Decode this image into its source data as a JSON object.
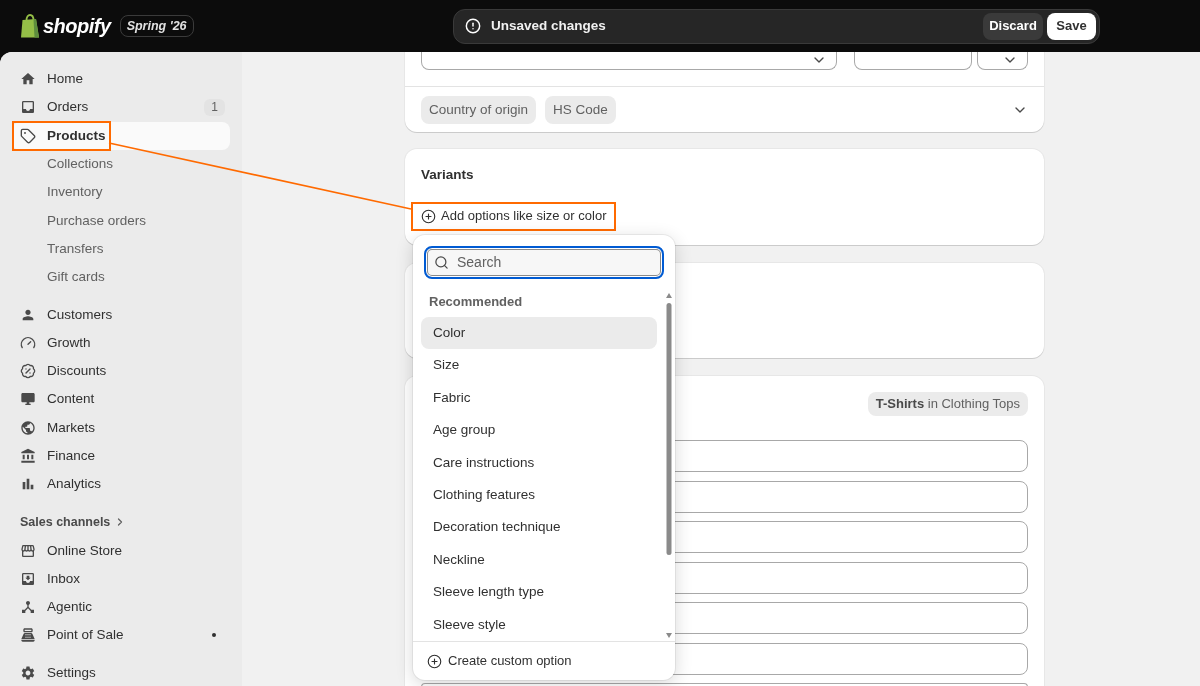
{
  "top_bar": {
    "logo": "shopify",
    "edition": "Spring '26",
    "save_bar": {
      "message": "Unsaved changes",
      "actions": [
        {
          "label": "Discard",
          "kind": "secondary"
        },
        {
          "label": "Save",
          "kind": "primary"
        }
      ]
    }
  },
  "sidebar": {
    "sections": [
      {
        "items": [
          {
            "label": "Home",
            "selected": false,
            "highlighted": false
          },
          {
            "label": "Orders",
            "selected": false,
            "highlighted": false,
            "badge": "1"
          },
          {
            "label": "Products",
            "selected": true,
            "highlighted": true,
            "children": [
              {
                "label": "Collections",
                "selected": false,
                "highlighted": false
              },
              {
                "label": "Inventory",
                "selected": false,
                "highlighted": false
              },
              {
                "label": "Purchase orders",
                "selected": false,
                "highlighted": false
              },
              {
                "label": "Transfers",
                "selected": false,
                "highlighted": false
              },
              {
                "label": "Gift cards",
                "selected": false,
                "highlighted": false
              }
            ]
          }
        ]
      },
      {
        "items": [
          {
            "label": "Customers",
            "selected": false,
            "highlighted": false
          },
          {
            "label": "Growth",
            "selected": false,
            "highlighted": false
          },
          {
            "label": "Discounts",
            "selected": false,
            "highlighted": false
          },
          {
            "label": "Content",
            "selected": false,
            "highlighted": false
          },
          {
            "label": "Markets",
            "selected": false,
            "highlighted": false
          },
          {
            "label": "Finance",
            "selected": false,
            "highlighted": false
          },
          {
            "label": "Analytics",
            "selected": false,
            "highlighted": false
          }
        ]
      },
      {
        "title": "Sales channels",
        "items": [
          {
            "label": "Online Store",
            "selected": false,
            "highlighted": false
          },
          {
            "label": "Inbox",
            "selected": false,
            "highlighted": false
          },
          {
            "label": "Agentic",
            "selected": false,
            "highlighted": false
          },
          {
            "label": "Point of Sale",
            "selected": false,
            "highlighted": false,
            "indicator": true
          }
        ]
      }
    ],
    "footer_item": {
      "label": "Settings",
      "selected": false,
      "highlighted": false
    }
  },
  "shipping_card": {
    "tags": [
      "Country of origin",
      "HS Code"
    ]
  },
  "variants_card": {
    "title": "Variants",
    "add_button": {
      "label": "Add options like size or color",
      "highlighted": true
    }
  },
  "category_card": {
    "category": "**T-Shirts** in Clothing Tops"
  },
  "option_menu": {
    "search": {
      "placeholder": "Search",
      "focused": true
    },
    "group_label": "Recommended",
    "options": [
      {
        "label": "Color",
        "selected": true
      },
      {
        "label": "Size",
        "selected": false
      },
      {
        "label": "Fabric",
        "selected": false
      },
      {
        "label": "Age group",
        "selected": false
      },
      {
        "label": "Care instructions",
        "selected": false
      },
      {
        "label": "Clothing features",
        "selected": false
      },
      {
        "label": "Decoration technique",
        "selected": false
      },
      {
        "label": "Neckline",
        "selected": false
      },
      {
        "label": "Sleeve length type",
        "selected": false
      },
      {
        "label": "Sleeve style",
        "selected": false
      }
    ],
    "footer_action": "Create custom option"
  }
}
